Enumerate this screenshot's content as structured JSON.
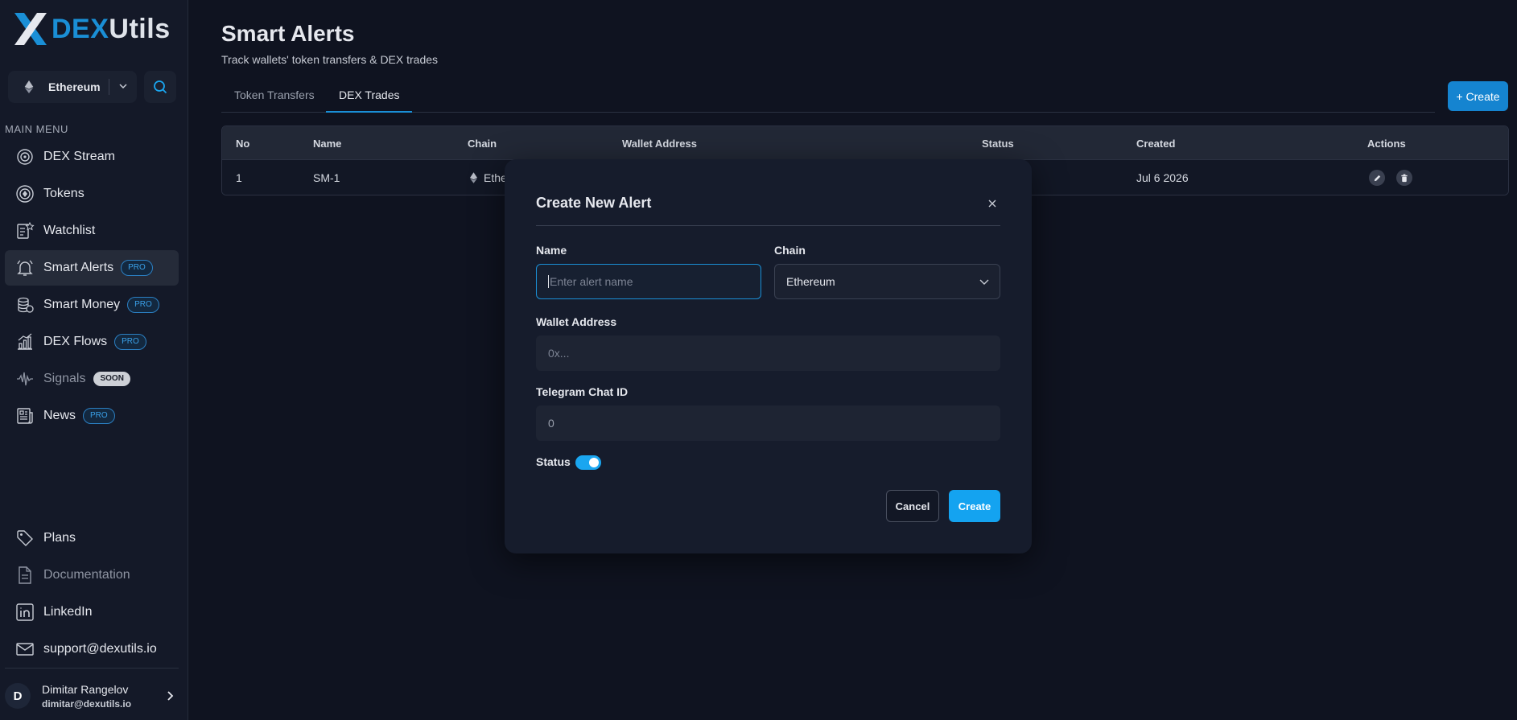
{
  "brand": {
    "dex": "DEX",
    "utils": "Utils"
  },
  "chain_selector": {
    "value": "Ethereum"
  },
  "sidebar": {
    "menu_title": "MAIN MENU",
    "items": [
      {
        "label": "DEX Stream",
        "badge": ""
      },
      {
        "label": "Tokens",
        "badge": ""
      },
      {
        "label": "Watchlist",
        "badge": ""
      },
      {
        "label": "Smart Alerts",
        "badge": "PRO"
      },
      {
        "label": "Smart Money",
        "badge": "PRO"
      },
      {
        "label": "DEX Flows",
        "badge": "PRO"
      },
      {
        "label": "Signals",
        "badge": "SOON"
      },
      {
        "label": "News",
        "badge": "PRO"
      }
    ],
    "footer_items": [
      {
        "label": "Plans"
      },
      {
        "label": "Documentation"
      },
      {
        "label": "LinkedIn"
      },
      {
        "label": "support@dexutils.io"
      }
    ],
    "user": {
      "initial": "D",
      "name": "Dimitar Rangelov",
      "email": "dimitar@dexutils.io"
    }
  },
  "page": {
    "title": "Smart Alerts",
    "subtitle": "Track wallets' token transfers & DEX trades",
    "tabs": [
      {
        "label": "Token Transfers"
      },
      {
        "label": "DEX Trades"
      }
    ],
    "create_label": "+ Create"
  },
  "table": {
    "headers": [
      "No",
      "Name",
      "Chain",
      "Wallet Address",
      "Status",
      "Created",
      "Actions"
    ],
    "rows": [
      {
        "no": "1",
        "name": "SM-1",
        "chain": "Ethe",
        "created": "Jul 6 2026"
      }
    ]
  },
  "modal": {
    "title": "Create New Alert",
    "name_label": "Name",
    "name_placeholder": "Enter alert name",
    "chain_label": "Chain",
    "chain_value": "Ethereum",
    "wallet_label": "Wallet Address",
    "wallet_placeholder": "0x...",
    "telegram_label": "Telegram Chat ID",
    "telegram_value": "0",
    "status_label": "Status",
    "status_on": true,
    "cancel_label": "Cancel",
    "create_label": "Create"
  },
  "colors": {
    "accent": "#1a8fd6",
    "bg": "#0f1320",
    "sidebar": "#141928",
    "modal": "#161c2c"
  }
}
